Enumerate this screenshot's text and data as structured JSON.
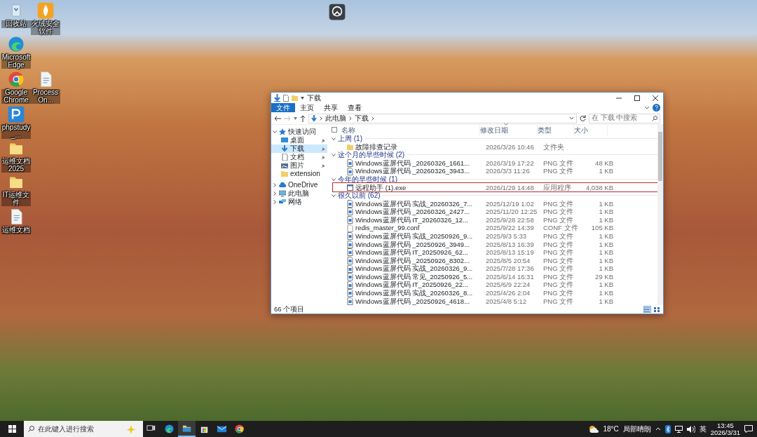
{
  "desktop": {
    "icons": [
      {
        "kind": "recycle",
        "label": "回收站"
      },
      {
        "kind": "flame",
        "label": "火绒安全软件"
      },
      {
        "kind": "edge",
        "label": "Microsoft Edge"
      },
      {
        "kind": "chrome",
        "label": "Google Chrome"
      },
      {
        "kind": "doc",
        "label": "ProcessOn..."
      },
      {
        "kind": "php",
        "label": "phpstudy_..."
      },
      {
        "kind": "folder",
        "label": "运维文档 2025"
      },
      {
        "kind": "folder",
        "label": "IT运维文件"
      },
      {
        "kind": "doc",
        "label": "运维文档"
      },
      {
        "kind": "camera"
      }
    ]
  },
  "explorer": {
    "title": "下载",
    "ribbon_tabs": [
      {
        "label": "文件",
        "selected": true
      },
      {
        "label": "主页",
        "selected": false
      },
      {
        "label": "共享",
        "selected": false
      },
      {
        "label": "查看",
        "selected": false
      }
    ],
    "breadcrumb": [
      "此电脑",
      "下载"
    ],
    "search": {
      "placeholder": "在 下载 中搜索"
    },
    "nav": [
      {
        "label": "快速访问",
        "kind": "star",
        "expanded": true,
        "selected": false,
        "children": [
          {
            "label": "桌面",
            "kind": "desktop",
            "pinned": true,
            "selected": false
          },
          {
            "label": "下载",
            "kind": "download",
            "pinned": true,
            "selected": true
          },
          {
            "label": "文档",
            "kind": "doc",
            "pinned": true,
            "selected": false
          },
          {
            "label": "图片",
            "kind": "picture",
            "pinned": true,
            "selected": false
          },
          {
            "label": "extension",
            "kind": "folder",
            "pinned": false,
            "selected": false
          }
        ]
      },
      {
        "label": "OneDrive",
        "kind": "cloud",
        "expanded": false,
        "selected": false
      },
      {
        "label": "此电脑",
        "kind": "pc",
        "expanded": false,
        "selected": false
      },
      {
        "label": "网络",
        "kind": "network",
        "expanded": false,
        "selected": false
      }
    ],
    "columns": [
      {
        "label": "名称",
        "sorted": false
      },
      {
        "label": "修改日期",
        "sorted": true
      },
      {
        "label": "类型",
        "sorted": false
      },
      {
        "label": "大小",
        "sorted": false
      }
    ],
    "groups": [
      {
        "label": "上周 (1)",
        "expanded": true,
        "files": [
          {
            "kind": "folder",
            "name": "故障排查记录",
            "date": "2026/3/26 10:46",
            "type": "文件夹",
            "annotated": false
          }
        ]
      },
      {
        "label": "这个月的早些时候 (2)",
        "expanded": true,
        "files": [
          {
            "kind": "png",
            "name": "Windows蓝屏代码 _20260326_1661...",
            "date": "2026/3/19 17:22",
            "type": "PNG 文件",
            "size": "48 KB",
            "annotated": false
          },
          {
            "kind": "png",
            "name": "Windows蓝屏代码 _20260326_3943...",
            "date": "2026/3/3 11:26",
            "type": "PNG 文件",
            "size": "1 KB",
            "annotated": false
          }
        ]
      },
      {
        "label": "今年的早些时候 (1)",
        "expanded": true,
        "files": [
          {
            "kind": "exe",
            "name": "远程助手 (1).exe",
            "date": "2026/1/29 14:48",
            "type": "应用程序",
            "size": "4,038 KB",
            "annotated": true
          }
        ]
      },
      {
        "label": "很久以前 (62)",
        "expanded": true,
        "files": [
          {
            "kind": "png",
            "name": "Windows蓝屏代码 实战_20260326_7...",
            "date": "2025/12/19 1:02",
            "type": "PNG 文件",
            "size": "1 KB",
            "annotated": false
          },
          {
            "kind": "png",
            "name": "Windows蓝屏代码 _20260326_2427...",
            "date": "2025/11/20 12:25",
            "type": "PNG 文件",
            "size": "1 KB",
            "annotated": false
          },
          {
            "kind": "png",
            "name": "Windows蓝屏代码 IT_20260326_12...",
            "date": "2025/9/28 22:58",
            "type": "PNG 文件",
            "size": "1 KB",
            "annotated": false
          },
          {
            "kind": "conf",
            "name": "redis_master_99.conf",
            "date": "2025/9/22 14:39",
            "type": "CONF 文件",
            "size": "105 KB",
            "annotated": false
          },
          {
            "kind": "png",
            "name": "Windows蓝屏代码 实战_20250926_9...",
            "date": "2025/9/3 5:33",
            "type": "PNG 文件",
            "size": "1 KB",
            "annotated": false
          },
          {
            "kind": "png",
            "name": "Windows蓝屏代码 _20250926_3949...",
            "date": "2025/8/13 16:39",
            "type": "PNG 文件",
            "size": "1 KB",
            "annotated": false
          },
          {
            "kind": "png",
            "name": "Windows蓝屏代码 IT_20250926_62...",
            "date": "2025/8/13 15:19",
            "type": "PNG 文件",
            "size": "1 KB",
            "annotated": false
          },
          {
            "kind": "png",
            "name": "Windows蓝屏代码 _20250926_8302...",
            "date": "2025/8/5 20:54",
            "type": "PNG 文件",
            "size": "1 KB",
            "annotated": false
          },
          {
            "kind": "png",
            "name": "Windows蓝屏代码 实战_20260326_9...",
            "date": "2025/7/28 17:36",
            "type": "PNG 文件",
            "size": "1 KB",
            "annotated": false
          },
          {
            "kind": "png",
            "name": "Windows蓝屏代码 常见_20250926_5...",
            "date": "2025/6/14 16:31",
            "type": "PNG 文件",
            "size": "29 KB",
            "annotated": false
          },
          {
            "kind": "png",
            "name": "Windows蓝屏代码 IT_20250926_22...",
            "date": "2025/6/9 22:24",
            "type": "PNG 文件",
            "size": "1 KB",
            "annotated": false
          },
          {
            "kind": "png",
            "name": "Windows蓝屏代码 实战_20260326_8...",
            "date": "2025/4/26 2:04",
            "type": "PNG 文件",
            "size": "1 KB",
            "annotated": false
          },
          {
            "kind": "png",
            "name": "Windows蓝屏代码 _20250926_4618...",
            "date": "2025/4/8 5:12",
            "type": "PNG 文件",
            "size": "1 KB",
            "annotated": false
          }
        ]
      }
    ],
    "status_bar": "66 个项目",
    "views": [
      {
        "kind": "details",
        "selected": true
      },
      {
        "kind": "tiles",
        "selected": false
      }
    ]
  },
  "taskbar": {
    "search": {
      "placeholder": "在此键入进行搜索"
    },
    "apps": [
      {
        "kind": "taskview",
        "active": false
      },
      {
        "kind": "edge",
        "active": false
      },
      {
        "kind": "explorer",
        "active": true
      },
      {
        "kind": "store",
        "active": false
      },
      {
        "kind": "mail",
        "active": false
      },
      {
        "kind": "chrome",
        "active": false
      }
    ],
    "weather": {
      "temperature": "18°C",
      "condition": "局部晴朗"
    },
    "language": "英",
    "time": "13:45",
    "date": "2026/3/31"
  }
}
